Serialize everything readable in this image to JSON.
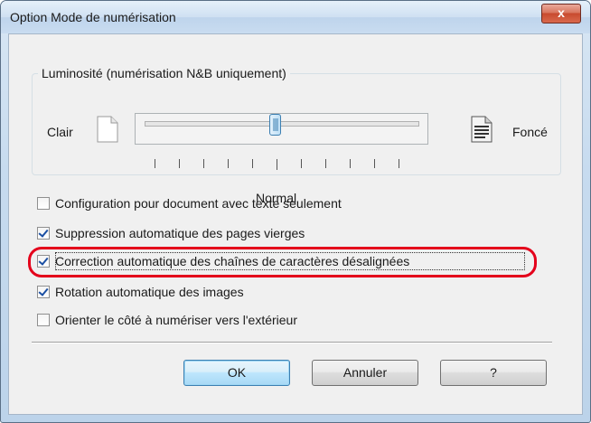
{
  "window": {
    "title": "Option Mode de numérisation",
    "close_label": "x"
  },
  "brightness": {
    "group_label": "Luminosité (numérisation N&B uniquement)",
    "left_label": "Clair",
    "right_label": "Foncé",
    "center_label": "Normal",
    "slider_position": 0.5
  },
  "options": [
    {
      "label": "Configuration pour document avec texte seulement",
      "checked": false
    },
    {
      "label": "Suppression automatique des pages vierges",
      "checked": true
    },
    {
      "label": "Correction automatique des chaînes de caractères désalignées",
      "checked": true
    },
    {
      "label": "Rotation automatique des images",
      "checked": true
    },
    {
      "label": "Orienter le côté à numériser vers l'extérieur",
      "checked": false
    }
  ],
  "buttons": {
    "ok_label": "OK",
    "cancel_label": "Annuler",
    "help_label": "?"
  },
  "colors": {
    "highlight": "#e4001b",
    "check": "#1b4fa3"
  }
}
